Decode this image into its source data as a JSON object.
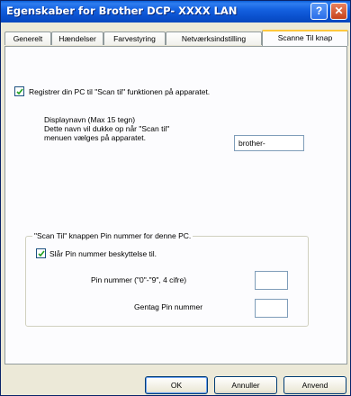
{
  "window": {
    "title": "Egenskaber for Brother  DCP- XXXX LAN"
  },
  "titlebar": {
    "help_label": "?",
    "close_label": "✕"
  },
  "tabs": [
    {
      "label": "Generelt"
    },
    {
      "label": "Hændelser"
    },
    {
      "label": "Farvestyring"
    },
    {
      "label": "Netværksindstilling"
    },
    {
      "label": "Scanne Til knap",
      "active": true
    }
  ],
  "register": {
    "label": "Registrer din PC til \"Scan til\" funktionen på apparatet.",
    "checked": true
  },
  "display_name": {
    "lines": [
      "Displaynavn (Max 15 tegn)",
      "Dette navn vil dukke op når \"Scan til\"",
      "menuen vælges på apparatet."
    ],
    "value": "brother-"
  },
  "pin_group": {
    "title": "\"Scan Til\" knappen Pin nummer for denne PC.",
    "enable_label": "Slår Pin nummer beskyttelse til.",
    "enable_checked": true,
    "pin_label": "Pin nummer (\"0\"-\"9\", 4 cifre)",
    "pin_value": "",
    "repeat_label": "Gentag Pin nummer",
    "repeat_value": ""
  },
  "buttons": {
    "ok": "OK",
    "cancel": "Annuller",
    "apply": "Anvend"
  }
}
